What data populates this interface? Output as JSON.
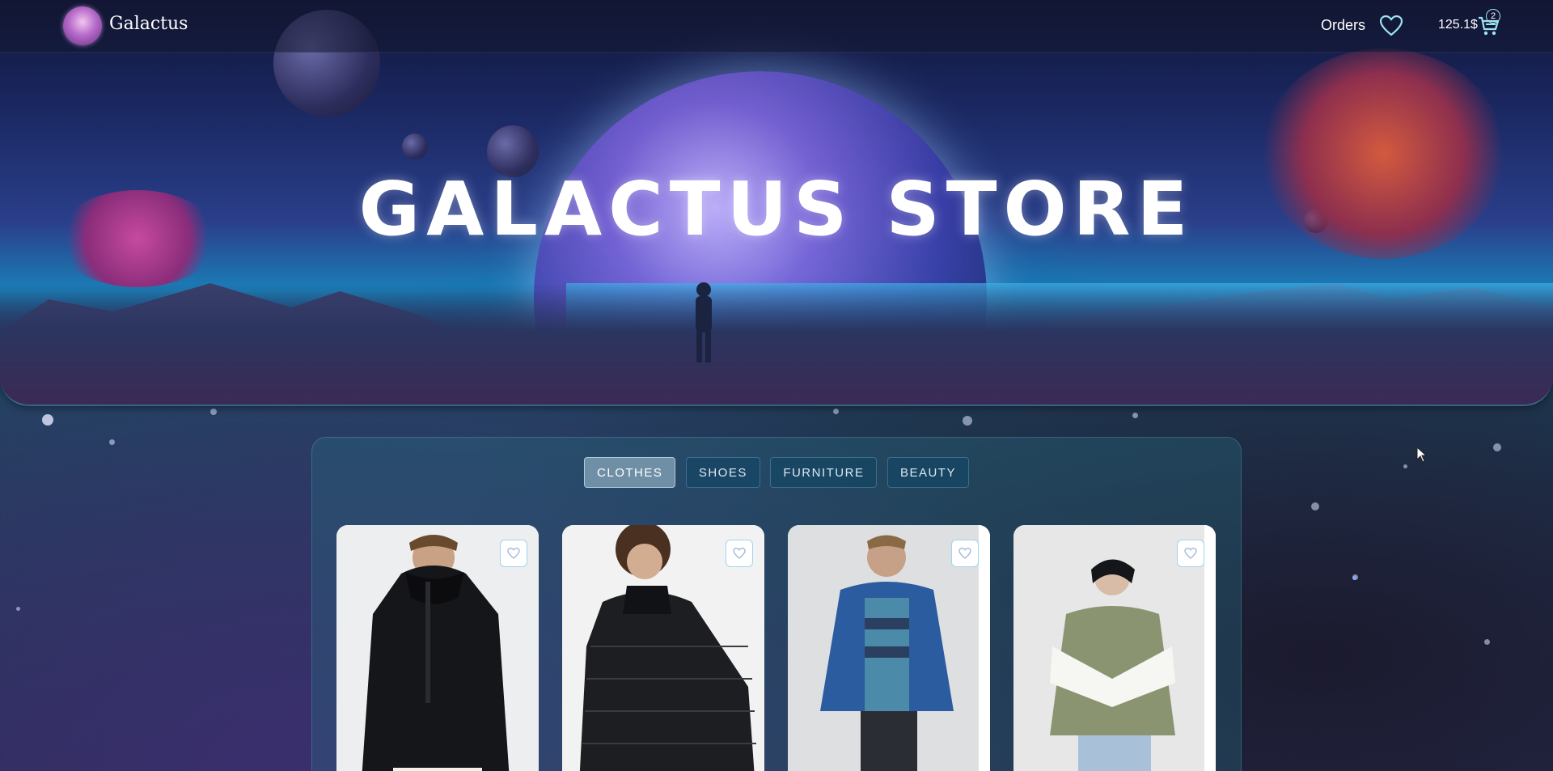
{
  "navbar": {
    "brand": "Galactus",
    "orders_label": "Orders",
    "favorites_icon": "heart-icon",
    "balance": "125.1$",
    "cart_icon": "cart-icon",
    "cart_count": "2"
  },
  "hero": {
    "title": "GALACTUS STORE"
  },
  "tabs": [
    {
      "label": "CLOTHES",
      "active": true
    },
    {
      "label": "SHOES",
      "active": false
    },
    {
      "label": "FURNITURE",
      "active": false
    },
    {
      "label": "BEAUTY",
      "active": false
    }
  ],
  "products": [
    {
      "image": "black hooded puffer jacket",
      "favorite_icon": "heart-icon"
    },
    {
      "image": "black quilted puffer jacket",
      "favorite_icon": "heart-icon"
    },
    {
      "image": "blue bomber jacket",
      "favorite_icon": "heart-icon"
    },
    {
      "image": "olive and white puffer jacket",
      "favorite_icon": "heart-icon"
    }
  ],
  "colors": {
    "accent": "#9ee3f2",
    "tab_bg": "#144664",
    "tab_active_bg": "#aac8d7",
    "card_bg": "#eef0f2"
  }
}
